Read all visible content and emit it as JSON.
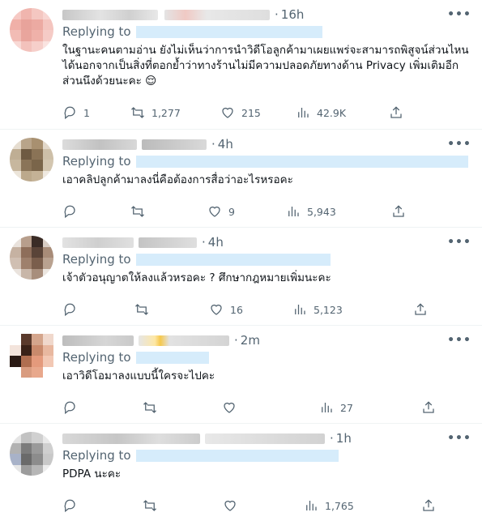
{
  "replies": [
    {
      "time": "16h",
      "replying_to": "Replying to",
      "text": "ในฐานะคนตามอ่าน ยังไม่เห็นว่าการนำวิดีโอลูกค้ามาเผยแพร่จะสามารถพิสูจน์ส่วนไหนได้นอกจากเป็นสิ่งที่ตอกย้ำว่าทางร้านไม่มีความปลอดภัยทางด้าน Privacy เพิ่มเติมอีกส่วนนึงด้วยนะคะ 😌",
      "replies": "1",
      "retweets": "1,277",
      "likes": "215",
      "views": "42.9K"
    },
    {
      "time": "4h",
      "replying_to": "Replying to",
      "text": "เอาคลิปลูกค้ามาลงนี่คือต้องการสื่อว่าอะไรหรอคะ",
      "replies": "",
      "retweets": "",
      "likes": "9",
      "views": "5,943"
    },
    {
      "time": "4h",
      "replying_to": "Replying to",
      "text": "เจ้าตัวอนุญาตให้ลงแล้วหรอคะ ? ศึกษากฎหมายเพิ่มนะคะ",
      "replies": "",
      "retweets": "",
      "likes": "16",
      "views": "5,123"
    },
    {
      "time": "2m",
      "replying_to": "Replying to",
      "text": "เอาวิดีโอมาลงแบบนี้ใครจะไปคะ",
      "replies": "",
      "retweets": "",
      "likes": "",
      "views": "27"
    },
    {
      "time": "1h",
      "replying_to": "Replying to",
      "text": "PDPA นะคะ",
      "replies": "",
      "retweets": "",
      "likes": "",
      "views": "1,765"
    }
  ],
  "icons": {
    "reply": "reply-icon",
    "retweet": "retweet-icon",
    "like": "heart-icon",
    "views": "views-icon",
    "share": "share-icon",
    "more": "more-icon"
  },
  "colors": {
    "muted": "#536471",
    "text": "#0f1419",
    "divider": "#eff3f4"
  }
}
